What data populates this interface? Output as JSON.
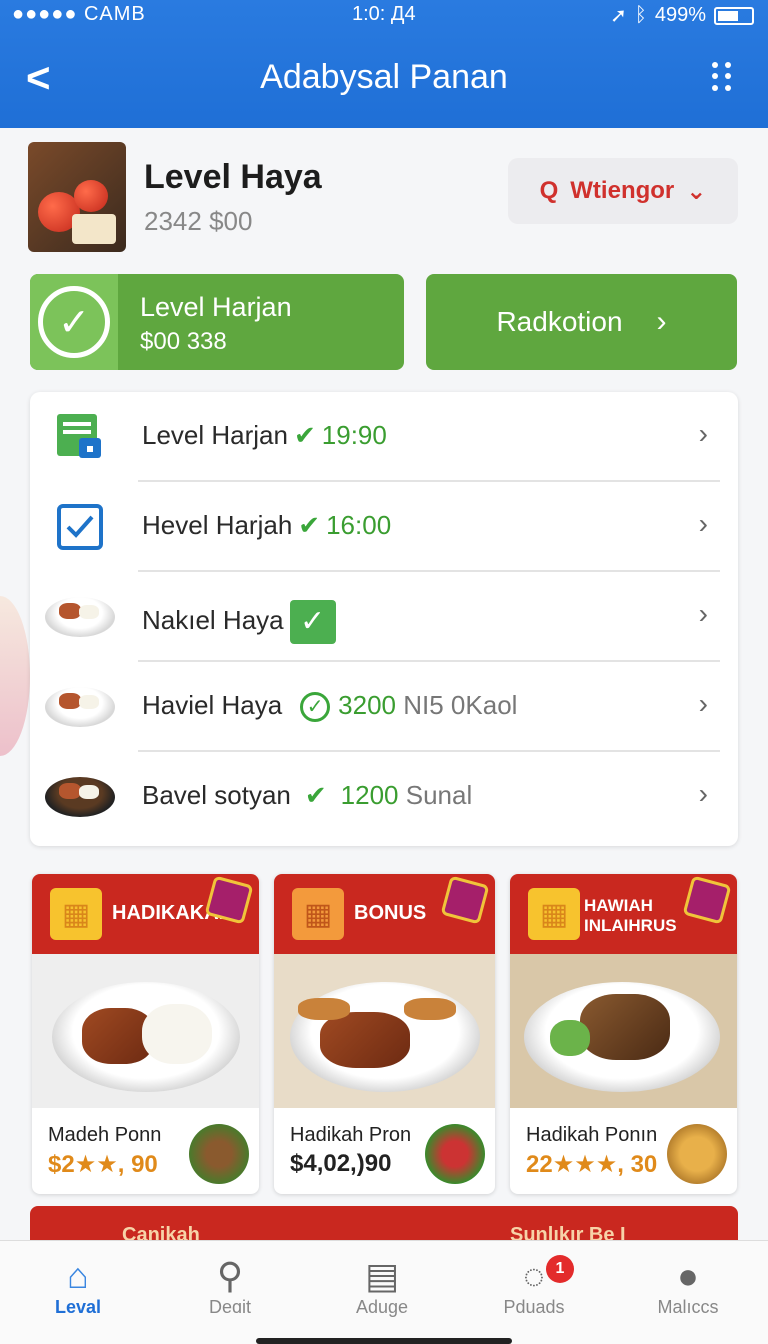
{
  "status_bar": {
    "carrier": "●●●●● CAMB",
    "time": "1:0: Д4",
    "battery": "499%"
  },
  "header": {
    "title": "Adabysal Panan"
  },
  "product": {
    "name": "Level Haya",
    "price": "2342 $00"
  },
  "dropdown": {
    "label": "Wtiengor"
  },
  "level_card": {
    "title": "Level Harjan",
    "amount": "$00 338"
  },
  "radkotion": {
    "label": "Radkotion"
  },
  "list_items": [
    {
      "label": "Level Harjan",
      "value": "19:90",
      "extra": ""
    },
    {
      "label": "Hevel Harjah",
      "value": "16:00",
      "extra": ""
    },
    {
      "label": "Nakıel Haya",
      "value": "",
      "extra": ""
    },
    {
      "label": "Haviel Haya",
      "value": "3200",
      "extra": "NI5 0Kaol"
    },
    {
      "label": "Bavel sotyan",
      "value": "1200",
      "extra": "Sunal"
    }
  ],
  "promos": [
    {
      "badge": "HADIKAKAN",
      "name": "Madeh Ponn",
      "price": "$2★★, 90"
    },
    {
      "badge": "BONUS",
      "name": "Hadikah Pron",
      "price": "$4,02,)90"
    },
    {
      "badge": "HAWIAH INLAIHRUS",
      "name": "Hadikah Ponın",
      "price": "22★★★, 30"
    }
  ],
  "promo_strip": {
    "left": "Canikah",
    "right": "Sunlıkır Be I"
  },
  "tabs": [
    {
      "label": "Leval",
      "icon": "home-icon"
    },
    {
      "label": "Deɑit",
      "icon": "search-icon"
    },
    {
      "label": "Aduge",
      "icon": "document-icon"
    },
    {
      "label": "Pduads",
      "icon": "chat-icon",
      "badge": "1"
    },
    {
      "label": "Malıccs",
      "icon": "profile-icon"
    }
  ],
  "colors": {
    "header_blue": "#1f6fd6",
    "green": "#5fa73f",
    "red": "#c9281f",
    "accent_red": "#d0312d"
  }
}
